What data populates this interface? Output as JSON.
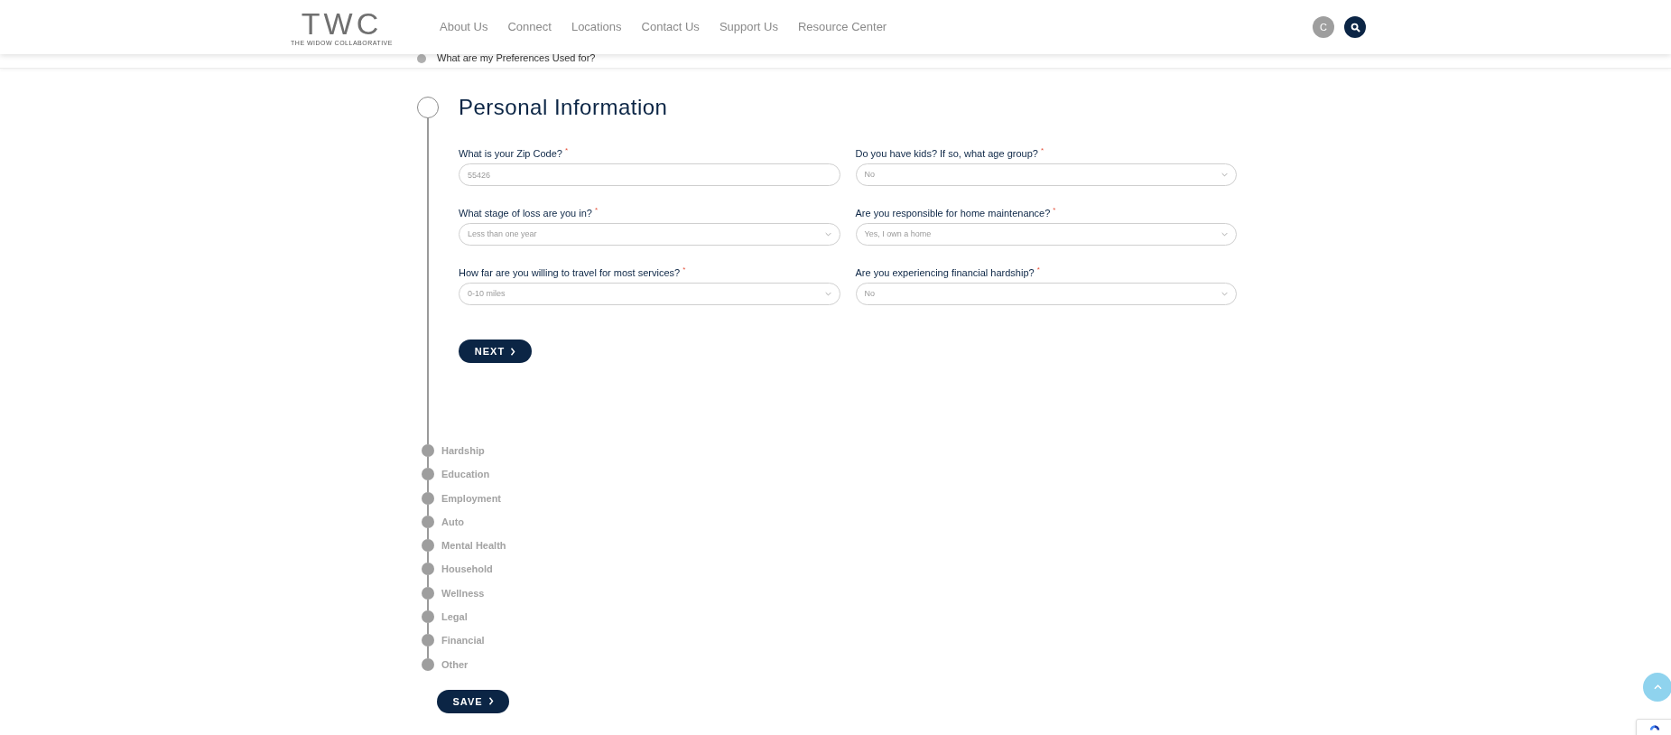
{
  "header": {
    "logo": {
      "letters": "TWC",
      "tagline": "THE WIDOW COLLABORATIVE"
    },
    "nav": [
      "About Us",
      "Connect",
      "Locations",
      "Contact Us",
      "Support Us",
      "Resource Center"
    ],
    "account_avatar": "C"
  },
  "faq_item": "What are my Preferences Used for?",
  "current_step": {
    "title": "Personal Information",
    "fields": [
      {
        "label": "What is your Zip Code?",
        "required_mark": "*",
        "kind": "input",
        "value": "55426"
      },
      {
        "label": "Do you have kids? If so, what age group?",
        "required_mark": "*",
        "kind": "select",
        "value": "No"
      },
      {
        "label": "What stage of loss are you in?",
        "required_mark": "*",
        "kind": "select",
        "value": "Less than one year"
      },
      {
        "label": "Are you responsible for home maintenance?",
        "required_mark": "*",
        "kind": "select",
        "value": "Yes, I own a home"
      },
      {
        "label": "How far are you willing to travel for most services?",
        "required_mark": "*",
        "kind": "select",
        "value": "0-10 miles"
      },
      {
        "label": "Are you experiencing financial hardship?",
        "required_mark": "*",
        "kind": "select",
        "value": "No"
      }
    ],
    "next_button": "NEXT"
  },
  "steps": [
    "Hardship",
    "Education",
    "Employment",
    "Auto",
    "Mental Health",
    "Household",
    "Wellness",
    "Legal",
    "Financial",
    "Other"
  ],
  "save_button": "SAVE"
}
